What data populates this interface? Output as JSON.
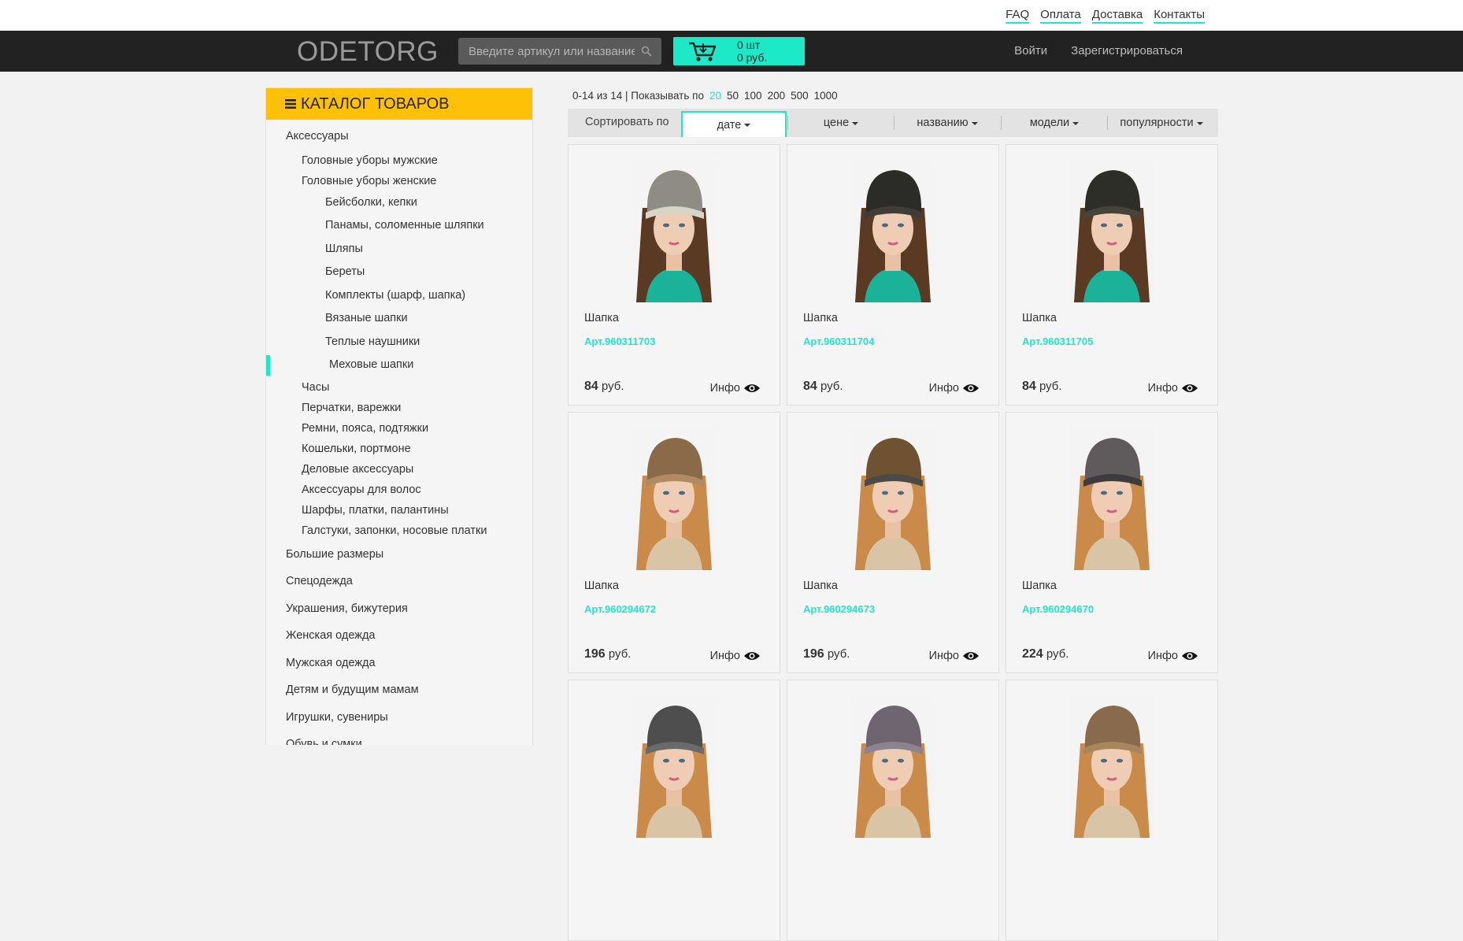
{
  "top_links": [
    "FAQ",
    "Оплата",
    "Доставка",
    "Контакты"
  ],
  "header": {
    "logo": "ODETORG",
    "search_placeholder": "Введите артикул или название",
    "cart_qty": "0 шт",
    "cart_sum": "0 руб.",
    "login": "Войти",
    "register": "Зарегистрироваться"
  },
  "sidebar": {
    "title": "КАТАЛОГ ТОВАРОВ",
    "items": [
      {
        "label": "Аксессуары",
        "level": 1
      },
      {
        "label": "Головные уборы мужские",
        "level": 2
      },
      {
        "label": "Головные уборы женские",
        "level": 2
      },
      {
        "label": "Бейсболки, кепки",
        "level": 3
      },
      {
        "label": "Панамы, соломенные шляпки",
        "level": 3
      },
      {
        "label": "Шляпы",
        "level": 3
      },
      {
        "label": "Береты",
        "level": 3
      },
      {
        "label": "Комплекты (шарф, шапка)",
        "level": 3
      },
      {
        "label": "Вязаные шапки",
        "level": 3
      },
      {
        "label": "Теплые наушники",
        "level": 3
      },
      {
        "label": "Меховые шапки",
        "level": 3,
        "active": true
      },
      {
        "label": "Часы",
        "level": 2
      },
      {
        "label": "Перчатки, варежки",
        "level": 2
      },
      {
        "label": "Ремни, пояса, подтяжки",
        "level": 2
      },
      {
        "label": "Кошельки, портмоне",
        "level": 2
      },
      {
        "label": "Деловые аксессуары",
        "level": 2
      },
      {
        "label": "Аксессуары для волос",
        "level": 2
      },
      {
        "label": "Шарфы, платки, палантины",
        "level": 2
      },
      {
        "label": "Галстуки, запонки, носовые платки",
        "level": 2
      },
      {
        "label": "Большие размеры",
        "level": 1
      },
      {
        "label": "Спецодежда",
        "level": 1
      },
      {
        "label": "Украшения, бижутерия",
        "level": 1
      },
      {
        "label": "Женская одежда",
        "level": 1
      },
      {
        "label": "Мужская одежда",
        "level": 1
      },
      {
        "label": "Детям и будущим мамам",
        "level": 1
      },
      {
        "label": "Игрушки, сувениры",
        "level": 1
      },
      {
        "label": "Обувь и сумки",
        "level": 1
      }
    ]
  },
  "pager": {
    "range": "0-14 из 14 | Показывать по",
    "options": [
      "20",
      "50",
      "100",
      "200",
      "500",
      "1000"
    ],
    "active": "20"
  },
  "sort": {
    "label": "Сортировать по",
    "options": [
      "дате",
      "цене",
      "названию",
      "модели",
      "популярности"
    ],
    "active": "дате"
  },
  "products": [
    {
      "name": "Шапка",
      "art": "Арт.960311703",
      "price": "84",
      "currency": "руб.",
      "info": "Инфо",
      "hat": "#8e8c84",
      "hat2": "#d8d4c8",
      "top": "#1ab39a",
      "hair": "#5a3a22"
    },
    {
      "name": "Шапка",
      "art": "Арт.960311704",
      "price": "84",
      "currency": "руб.",
      "info": "Инфо",
      "hat": "#2b2b28",
      "hat2": "#3f3d36",
      "top": "#1ab39a",
      "hair": "#5a3a22"
    },
    {
      "name": "Шапка",
      "art": "Арт.960311705",
      "price": "84",
      "currency": "руб.",
      "info": "Инфо",
      "hat": "#2e2e29",
      "hat2": "#45433a",
      "top": "#1ab39a",
      "hair": "#5a3a22"
    },
    {
      "name": "Шапка",
      "art": "Арт.960294672",
      "price": "196",
      "currency": "руб.",
      "info": "Инфо",
      "hat": "#8b6a4a",
      "hat2": "#b08a62",
      "top": "#d9c4a6",
      "hair": "#c98a4a"
    },
    {
      "name": "Шапка",
      "art": "Арт.960294673",
      "price": "196",
      "currency": "руб.",
      "info": "Инфо",
      "hat": "#6e5232",
      "hat2": "#4a4a48",
      "top": "#d9c4a6",
      "hair": "#c98a4a"
    },
    {
      "name": "Шапка",
      "art": "Арт.960294670",
      "price": "224",
      "currency": "руб.",
      "info": "Инфо",
      "hat": "#5f5a5c",
      "hat2": "#3d3b3d",
      "top": "#d9c4a6",
      "hair": "#c98a4a"
    },
    {
      "name": "",
      "art": "",
      "price": "",
      "currency": "",
      "info": "",
      "hat": "#4e4e4e",
      "hat2": "#6a6a6a",
      "top": "#d9c4a6",
      "hair": "#c98a4a"
    },
    {
      "name": "",
      "art": "",
      "price": "",
      "currency": "",
      "info": "",
      "hat": "#6f6570",
      "hat2": "#8c8290",
      "top": "#d9c4a6",
      "hair": "#c98a4a"
    },
    {
      "name": "",
      "art": "",
      "price": "",
      "currency": "",
      "info": "",
      "hat": "#8a6a4c",
      "hat2": "#a9855e",
      "top": "#d9c4a6",
      "hair": "#c98a4a"
    }
  ],
  "colors": {
    "accent": "#1de9c8",
    "catalog_header": "#ffc107",
    "navbar": "#222222"
  }
}
